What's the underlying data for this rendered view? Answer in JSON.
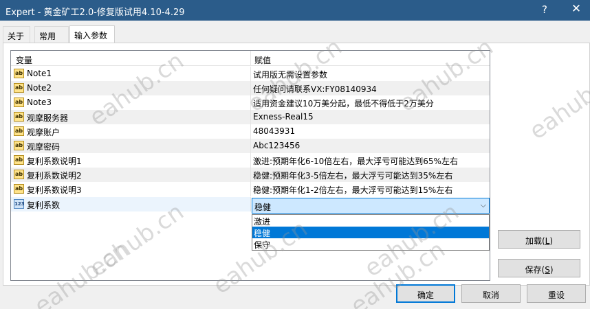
{
  "window": {
    "title": "Expert - 黄金矿工2.0-修复版试用4.10-4.29",
    "help_label": "?",
    "close_label": "✕"
  },
  "tabs": [
    {
      "label": "关于"
    },
    {
      "label": "常用"
    },
    {
      "label": "输入参数"
    }
  ],
  "grid": {
    "header": {
      "variable": "变量",
      "value": "赋值"
    },
    "rows": [
      {
        "name": "Note1",
        "value": "试用版无需设置参数",
        "type": "ab"
      },
      {
        "name": "Note2",
        "value": "任何疑问请联系VX:FY08140934",
        "type": "ab"
      },
      {
        "name": "Note3",
        "value": "适用资金建议10万美分起，最低不得低于2万美分",
        "type": "ab"
      },
      {
        "name": "观摩服务器",
        "value": "Exness-Real15",
        "type": "ab"
      },
      {
        "name": "观摩账户",
        "value": "48043931",
        "type": "ab"
      },
      {
        "name": "观摩密码",
        "value": "Abc123456",
        "type": "ab"
      },
      {
        "name": "复利系数说明1",
        "value": "激进:预期年化6-10倍左右，最大浮亏可能达到65%左右",
        "type": "ab"
      },
      {
        "name": "复利系数说明2",
        "value": "稳健:预期年化3-5倍左右，最大浮亏可能达到35%左右",
        "type": "ab"
      },
      {
        "name": "复利系数说明3",
        "value": "稳健:预期年化1-2倍左右，最大浮亏可能达到15%左右",
        "type": "ab"
      },
      {
        "name": "复利系数",
        "value": "稳健",
        "type": "123"
      }
    ],
    "icon_labels": {
      "ab": "ab",
      "num": "123"
    }
  },
  "combo": {
    "selected": "稳健",
    "options": [
      "激进",
      "稳健",
      "保守"
    ],
    "arrow": "⌵"
  },
  "buttons": {
    "load": {
      "text": "加载(",
      "key": "L",
      "end": ")"
    },
    "save": {
      "text": "保存(",
      "key": "S",
      "end": ")"
    },
    "ok": "确定",
    "cancel": "取消",
    "reset": "重设"
  },
  "watermark": "eahub.cn",
  "colors": {
    "titlebar": "#2b5c8a",
    "accent": "#0078d7",
    "combo_bg": "#cde8ff"
  }
}
